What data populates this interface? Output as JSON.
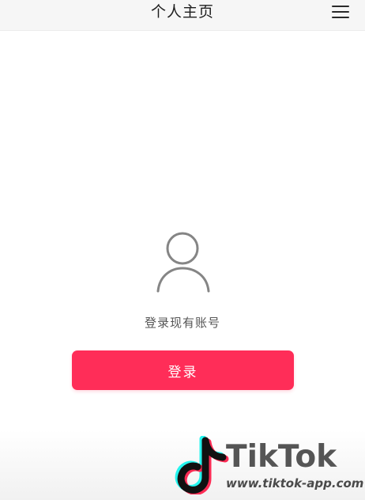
{
  "header": {
    "title": "个人主页",
    "menu_icon": "hamburger-menu-icon"
  },
  "profile": {
    "avatar_icon": "user-avatar-icon",
    "prompt": "登录现有账号",
    "login_button_label": "登录"
  },
  "watermark": {
    "brand": "TikTok",
    "url": "www.tiktok-app.com",
    "logo_icon": "tiktok-note-logo-icon"
  },
  "colors": {
    "accent": "#ff2d58",
    "header_background": "#f6f6f6",
    "text_primary": "#1d1d1d",
    "text_secondary": "#555555",
    "logo_cyan": "#25f4ee",
    "logo_pink": "#fe2c55"
  }
}
